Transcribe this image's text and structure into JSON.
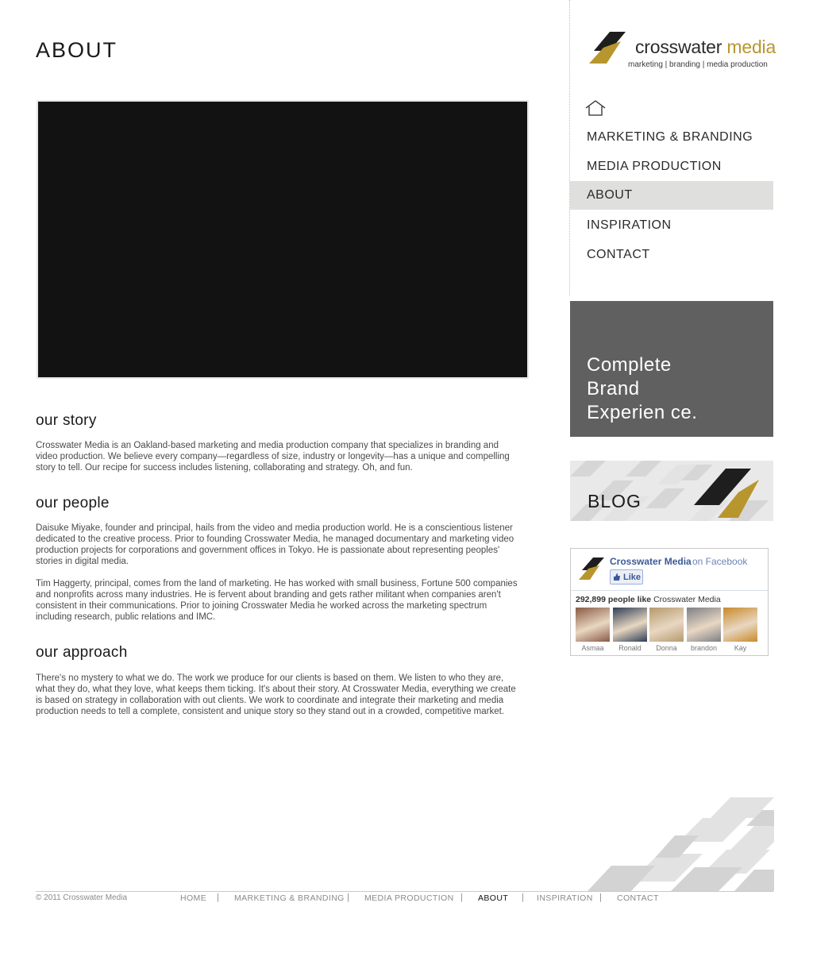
{
  "page": {
    "title": "ABOUT"
  },
  "brand": {
    "name_first": "crosswater",
    "name_second": "media",
    "tagline": "marketing | branding | media production",
    "gold": "#b8962e",
    "dark": "#1e1e1e"
  },
  "sections": [
    {
      "heading": "our story",
      "paragraphs": [
        "Crosswater Media is an Oakland-based marketing and media production company that specializes in branding and video production. We believe every company—regardless of size, industry or longevity—has a unique and compelling story to tell. Our recipe for success includes listening, collaborating and strategy. Oh, and fun."
      ]
    },
    {
      "heading": "our people",
      "paragraphs": [
        "Daisuke Miyake, founder and principal, hails from the video and media production world. He is a conscientious listener dedicated to the creative process. Prior to founding Crosswater Media, he managed documentary and marketing video production projects for corporations and government offices in Tokyo. He is passionate about representing peoples' stories in digital media.",
        "Tim Haggerty, principal, comes from the land of marketing. He has worked with small business, Fortune 500 companies and nonprofits across many industries. He is fervent about branding and gets rather militant when companies aren't consistent in their communications. Prior to joining Crosswater Media he worked across the marketing spectrum including research, public relations and IMC."
      ]
    },
    {
      "heading": "our approach",
      "paragraphs": [
        "There's no mystery to what we do. The work we produce for our clients is based on them. We listen to who they are, what they do, what they love, what keeps them ticking. It's about their story. At Crosswater Media, everything we create is based on strategy in collaboration with out clients. We work to coordinate and integrate their marketing and media production needs to tell a complete, consistent and unique story so they stand out in a crowded, competitive market."
      ]
    }
  ],
  "nav": {
    "home_icon": "home-icon",
    "items": [
      {
        "label": "MARKETING & BRANDING",
        "active": false
      },
      {
        "label": "MEDIA PRODUCTION",
        "active": false
      },
      {
        "label": "ABOUT",
        "active": true
      },
      {
        "label": "INSPIRATION",
        "active": false
      },
      {
        "label": "CONTACT",
        "active": false
      }
    ]
  },
  "promo": {
    "line1": "Complete",
    "line2": "Brand",
    "line3": "Experien ce."
  },
  "blog": {
    "label": "BLOG"
  },
  "facebook": {
    "page_name": "Crosswater Media",
    "on_label": "on Facebook",
    "like_label": "Like",
    "count_text": "292,899 people like",
    "count_page": "Crosswater Media",
    "fans": [
      {
        "name": "Asmaa",
        "color": "#8a5a44"
      },
      {
        "name": "Ronald",
        "color": "#2f3e55"
      },
      {
        "name": "Donna",
        "color": "#b59a6e"
      },
      {
        "name": "brandon",
        "color": "#7d7f86"
      },
      {
        "name": "Kay",
        "color": "#c98a2a"
      }
    ]
  },
  "footer": {
    "copyright": "© 2011 Crosswater Media",
    "links": [
      {
        "label": "HOME",
        "active": false
      },
      {
        "label": "MARKETING & BRANDING",
        "active": false
      },
      {
        "label": "MEDIA PRODUCTION",
        "active": false
      },
      {
        "label": "ABOUT",
        "active": true
      },
      {
        "label": "INSPIRATION",
        "active": false
      },
      {
        "label": "CONTACT",
        "active": false
      }
    ],
    "separator": "|"
  }
}
